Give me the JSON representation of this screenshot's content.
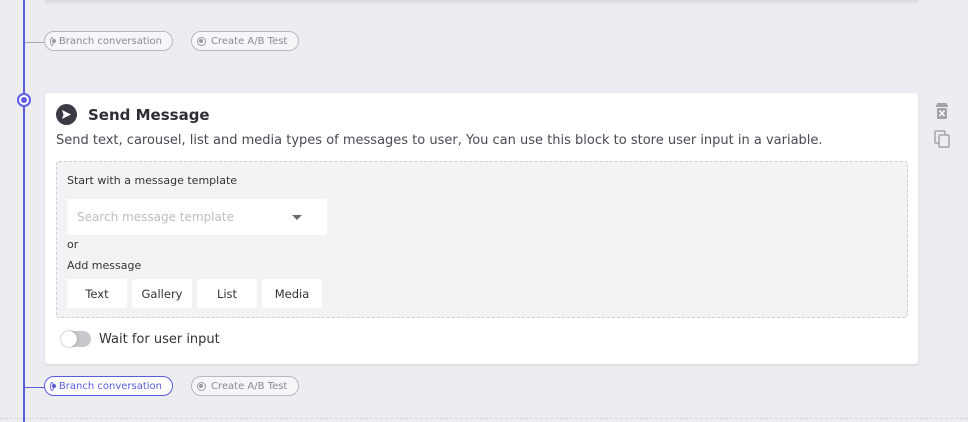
{
  "top_branch": {
    "branch_label": "Branch conversation",
    "ab_label": "Create A/B Test"
  },
  "card": {
    "title": "Send Message",
    "description": "Send text, carousel, list and media types of messages to user, You can use this block to store user input in a variable.",
    "template_label": "Start with a message template",
    "search_placeholder": "Search message template",
    "or_text": "or",
    "add_message_label": "Add message",
    "buttons": {
      "text": "Text",
      "gallery": "Gallery",
      "list": "List",
      "media": "Media"
    },
    "wait_label": "Wait for user input",
    "wait_enabled": false
  },
  "bottom_branch": {
    "branch_label": "Branch conversation",
    "ab_label": "Create A/B Test",
    "branch_active": true
  },
  "icons": {
    "header": "send-icon",
    "delete": "trash-icon",
    "copy": "copy-icon"
  },
  "colors": {
    "accent": "#5b5be0",
    "background": "#ededf1",
    "card": "#ffffff"
  }
}
